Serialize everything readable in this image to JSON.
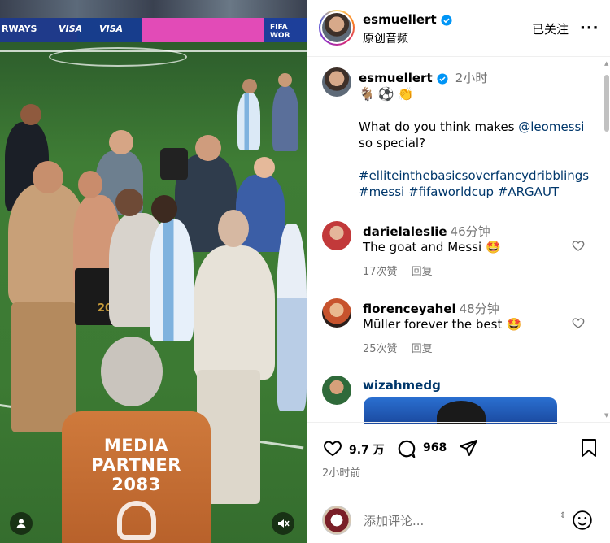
{
  "media": {
    "board_texts": [
      "RWAYS",
      "VISA",
      "VISA",
      "FIFA WOR"
    ],
    "vest": {
      "line1": "MEDIA",
      "line2": "PARTNER",
      "line3": "2083"
    },
    "player_number": "20",
    "icons": {
      "tag": "person-tag-icon",
      "audio": "muted-speaker-icon"
    }
  },
  "post": {
    "author": {
      "username": "esmuellert",
      "verified": true,
      "audio_label": "原创音频"
    },
    "follow_label": "已关注",
    "more_label": "···",
    "caption": {
      "username": "esmuellert",
      "time": "2小时",
      "emojis": [
        "🐐",
        "⚽",
        "👏"
      ],
      "line1_prefix": "What do you think makes ",
      "line1_mention": "@leomessi",
      "line2": "so special?",
      "hashtags_line1": "#elliteinthebasicsoverfancydribblings",
      "hashtags_line2": "#messi #fifaworldcup #ARGAUT"
    },
    "comments": [
      {
        "username": "darielaleslie",
        "time": "46分钟",
        "text": "The goat and Messi",
        "emoji": "🤩",
        "likes": "17次赞",
        "reply": "回复"
      },
      {
        "username": "florenceyahel",
        "time": "48分钟",
        "text": "Müller forever the best",
        "emoji": "🤩",
        "likes": "25次赞",
        "reply": "回复"
      },
      {
        "username": "wizahmedg"
      }
    ],
    "actions": {
      "likes_count": "9.7 万",
      "comments_count": "968"
    },
    "time_ago": "2小时前",
    "comment_input": {
      "placeholder": "添加评论..."
    }
  },
  "colors": {
    "verified": "#0095f6",
    "link": "#00376b",
    "muted": "#737373",
    "divider": "#efefef"
  }
}
